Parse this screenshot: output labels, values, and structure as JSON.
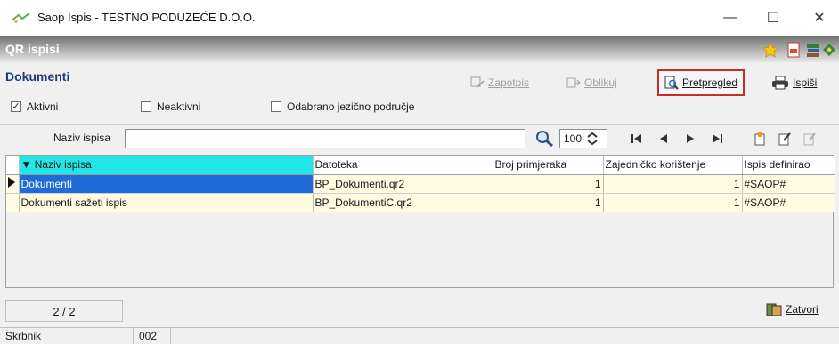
{
  "window": {
    "title": "Saop Ispis - TESTNO PODUZEĆE D.O.O.",
    "min_glyph": "—",
    "max_glyph": "☐",
    "close_glyph": "✕"
  },
  "form": {
    "title": "QR ispisi"
  },
  "section": {
    "title": "Dokumenti"
  },
  "toolbar": {
    "zapotpis": "Zapotpis",
    "oblikuj": "Oblikuj",
    "pretpregled": "Pretpregled",
    "ispisi": "Ispiši"
  },
  "filters": {
    "aktivni": {
      "label": "Aktivni",
      "checked": true
    },
    "neaktivni": {
      "label": "Neaktivni",
      "checked": false
    },
    "jezicno": {
      "label": "Odabrano jezično područje",
      "checked": false
    }
  },
  "search": {
    "label": "Naziv ispisa",
    "value": "",
    "page_size": "100"
  },
  "grid": {
    "columns": [
      "Naziv ispisa",
      "Datoteka",
      "Broj primjeraka",
      "Zajedničko korištenje",
      "Ispis definirao"
    ],
    "sort_indicator": "▼",
    "rows": [
      {
        "naziv": "Dokumenti",
        "datoteka": "BP_Dokumenti.qr2",
        "broj": "1",
        "zajednicko": "1",
        "definirao": "#SAOP#"
      },
      {
        "naziv": "Dokumenti sažeti ispis",
        "datoteka": "BP_DokumentiC.qr2",
        "broj": "1",
        "zajednicko": "1",
        "definirao": "#SAOP#"
      }
    ]
  },
  "footer": {
    "counter": "2 / 2",
    "zatvori": "Zatvori"
  },
  "status": {
    "user": "Skrbnik",
    "code": "002"
  },
  "colors": {
    "accent_header": "#22e6e6",
    "selection": "#1f6bd8",
    "highlight_border": "#cc2a2a",
    "section_title": "#1c3d7a"
  }
}
